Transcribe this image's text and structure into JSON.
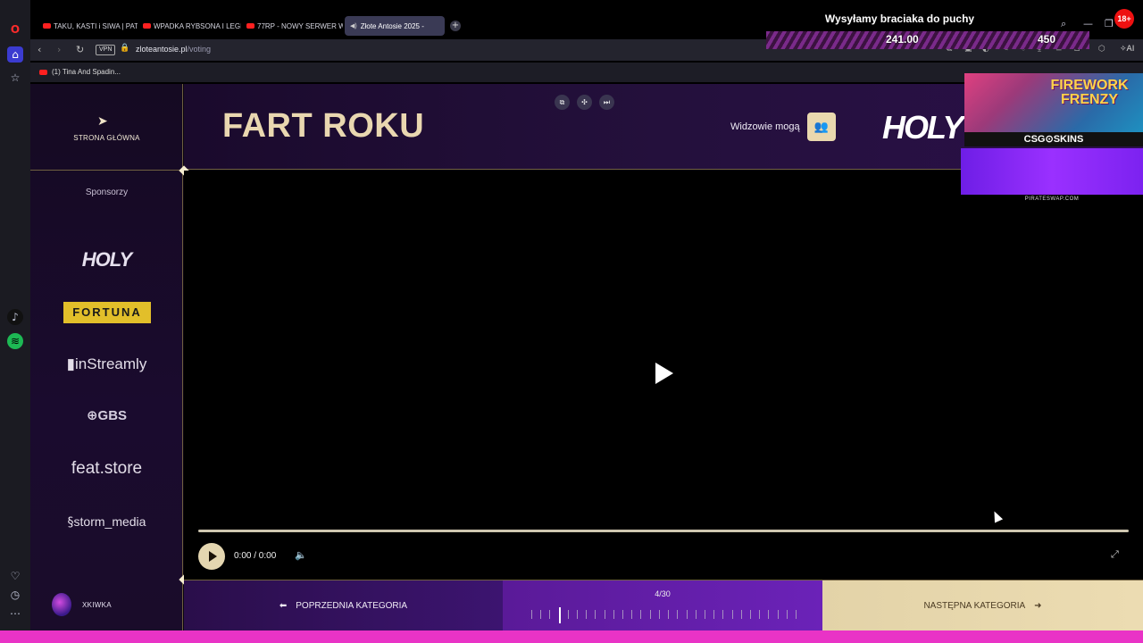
{
  "browser": {
    "tabs": [
      {
        "label": "TAKU, KASTI i SIWA | PATR"
      },
      {
        "label": "WPADKA RYBSONA I LEGI"
      },
      {
        "label": "77RP - NOWY SERWER W"
      },
      {
        "label": "Złote Antosie 2025 - "
      }
    ],
    "url_domain": "zloteantosie.pl",
    "url_path": "/voting",
    "vpn_label": "VPN",
    "bookmark": "(1) Tina And Spadin...",
    "ai_label": "AI"
  },
  "stream_overlay": {
    "title": "Wysyłamy braciaka do puchy",
    "amount_left": "241.00",
    "amount_right": "450",
    "age_badge": "18+",
    "ad_headline": "FIREWORK FRENZY",
    "ad_brand": "CSG⊙SKINS",
    "ad_url": "PIRATESWAP.COM"
  },
  "sidebar": {
    "home_label": "STRONA GŁÓWNA",
    "sponsors_title": "Sponsorzy",
    "sponsors": [
      "HOLY",
      "FORTUNA",
      "inStreamly",
      "GBS",
      "feat.store",
      "storm_media"
    ],
    "username": "XKIWKA"
  },
  "header": {
    "category_title": "FART ROKU",
    "viewers_label": "Widzowie mogą",
    "sponsor_logo": "HOLY"
  },
  "player": {
    "time": "0:00 / 0:00",
    "progress": 0
  },
  "nav": {
    "prev_label": "POPRZEDNIA KATEGORIA",
    "next_label": "NASTĘPNA KATEGORIA",
    "counter": "4/30",
    "current": 4,
    "total": 30
  },
  "colors": {
    "accent_gold": "#e9d7b0",
    "accent_purple": "#6b22b8",
    "overlay_pink": "#e933c6"
  }
}
